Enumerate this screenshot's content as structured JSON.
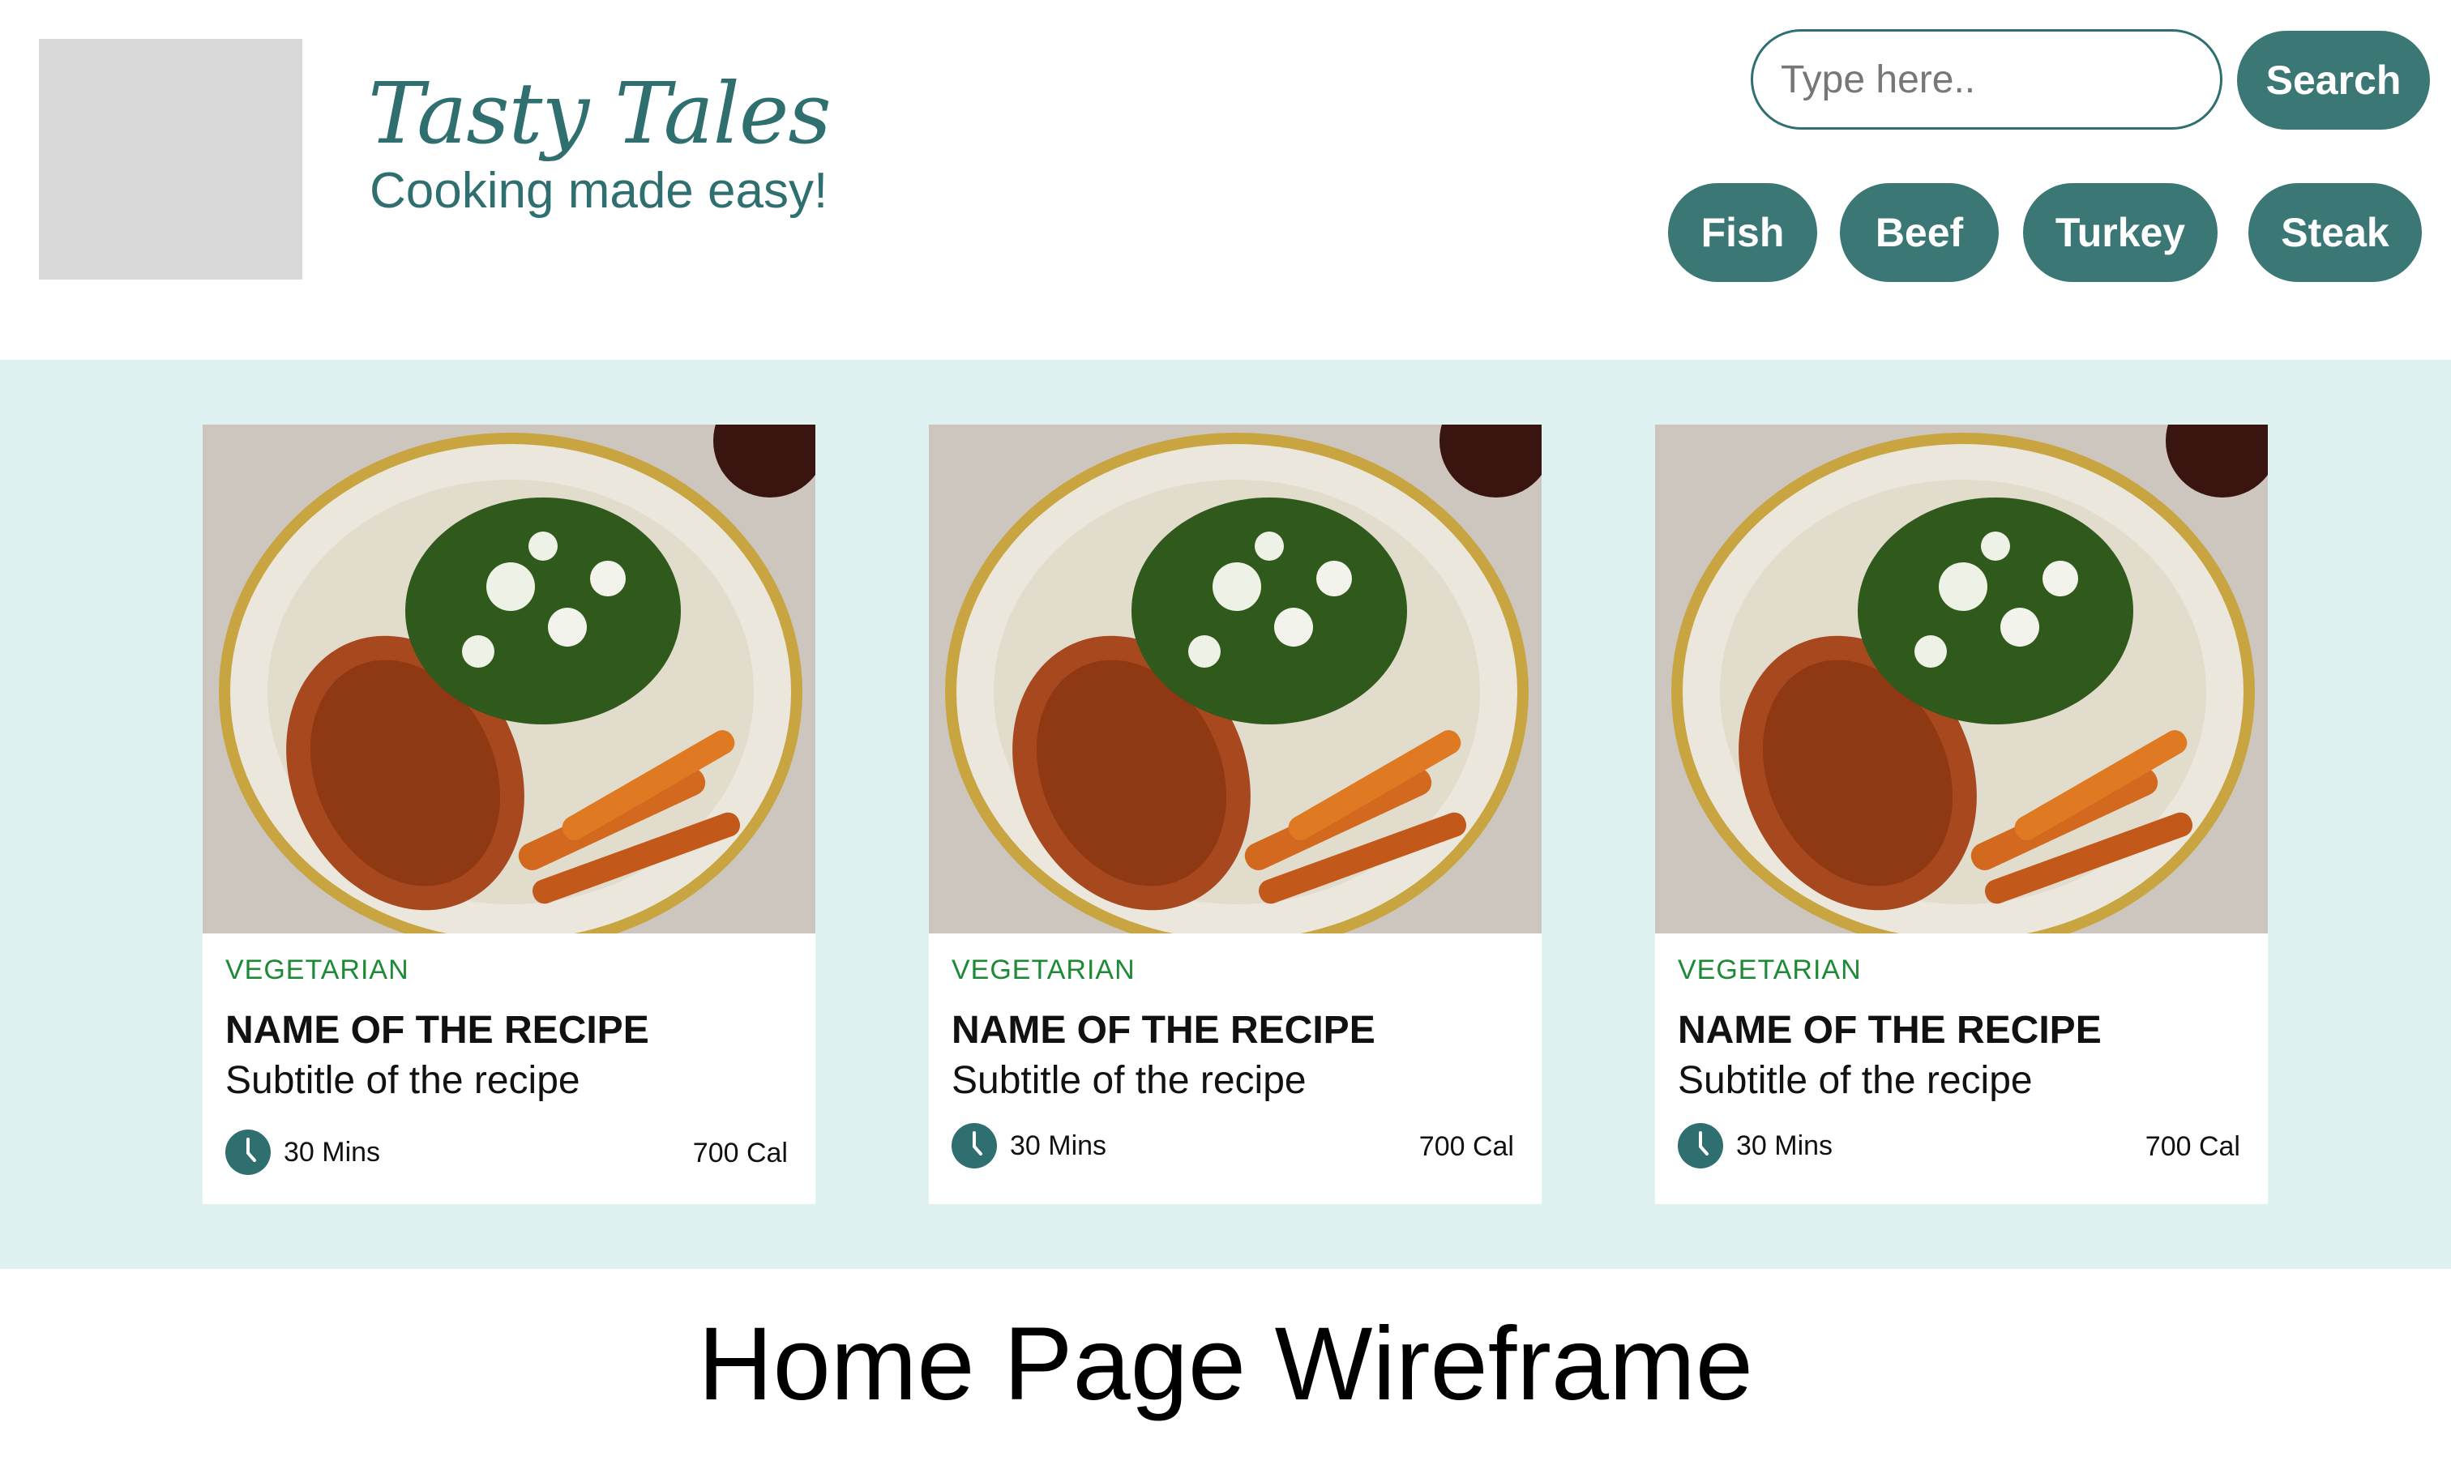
{
  "header": {
    "brand_title": "Tasty Tales",
    "brand_tagline": "Cooking made easy!",
    "search_placeholder": "Type here..",
    "search_button_label": "Search",
    "chips": [
      "Fish",
      "Beef",
      "Turkey",
      "Steak"
    ]
  },
  "cards": [
    {
      "category": "VEGETARIAN",
      "title": "NAME OF THE RECIPE",
      "subtitle": "Subtitle of the recipe",
      "time": "30 Mins",
      "calories": "700 Cal"
    },
    {
      "category": "VEGETARIAN",
      "title": "NAME OF THE RECIPE",
      "subtitle": "Subtitle of the recipe",
      "time": "30 Mins",
      "calories": "700 Cal"
    },
    {
      "category": "VEGETARIAN",
      "title": "NAME OF THE RECIPE",
      "subtitle": "Subtitle of the recipe",
      "time": "30 Mins",
      "calories": "700 Cal"
    }
  ],
  "caption": "Home Page Wireframe",
  "colors": {
    "brand": "#2f6f6f",
    "button": "#3a7775",
    "band": "#dff2f1",
    "category": "#1f8a36"
  },
  "icons": {
    "clock": "clock-icon",
    "photo": "food-photo"
  }
}
